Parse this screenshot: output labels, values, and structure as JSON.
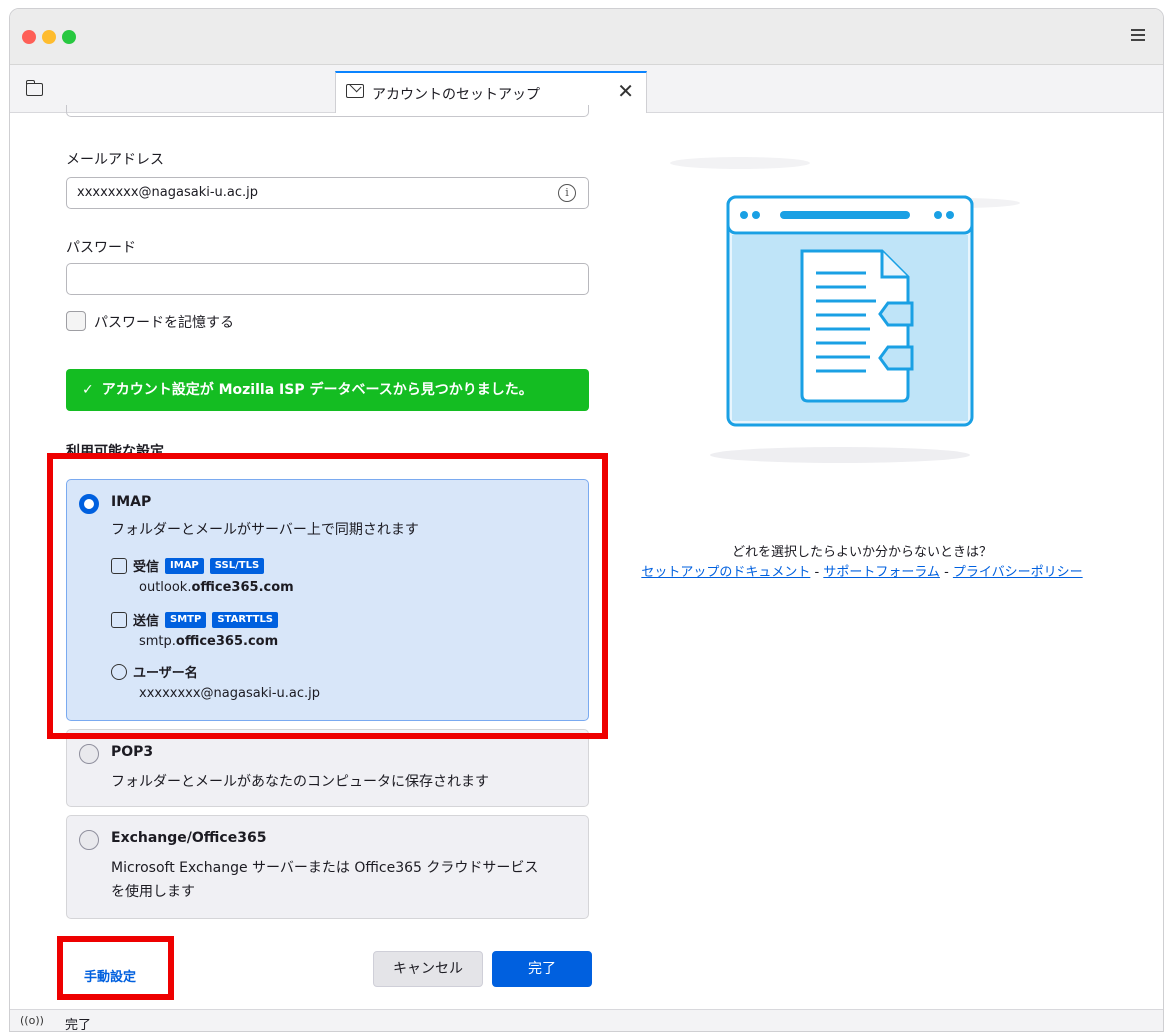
{
  "window": {
    "tab_title": "アカウントのセットアップ",
    "tab_close": "✕"
  },
  "form": {
    "email_label": "メールアドレス",
    "email_value": "xxxxxxxx@nagasaki-u.ac.jp",
    "password_label": "パスワード",
    "password_value": "",
    "remember_password_label": "パスワードを記憶する",
    "remember_password_checked": false
  },
  "notice": {
    "check": "✓",
    "text": "アカウント設定が Mozilla ISP データベースから見つかりました。"
  },
  "available": {
    "title": "利用可能な設定",
    "options": [
      {
        "title": "IMAP",
        "desc": "フォルダーとメールがサーバー上で同期されます",
        "selected": true,
        "incoming_label": "受信",
        "incoming_badges": [
          "IMAP",
          "SSL/TLS"
        ],
        "incoming_host_prefix": "outlook.",
        "incoming_host_bold": "office365.com",
        "outgoing_label": "送信",
        "outgoing_badges": [
          "SMTP",
          "STARTTLS"
        ],
        "outgoing_host_prefix": "smtp.",
        "outgoing_host_bold": "office365.com",
        "username_label": "ユーザー名",
        "username_value": "xxxxxxxx@nagasaki-u.ac.jp"
      },
      {
        "title": "POP3",
        "desc": "フォルダーとメールがあなたのコンピュータに保存されます",
        "selected": false
      },
      {
        "title": "Exchange/Office365",
        "desc": "Microsoft Exchange サーバーまたは Office365 クラウドサービスを使用します",
        "selected": false
      }
    ]
  },
  "actions": {
    "manual": "手動設定",
    "cancel": "キャンセル",
    "done": "完了"
  },
  "help": {
    "question": "どれを選択したらよいか分からないときは？",
    "link_docs": "セットアップのドキュメント",
    "sep1": " - ",
    "link_forum": "サポートフォーラム",
    "sep2": " - ",
    "link_privacy": "プライバシーポリシー"
  },
  "status": {
    "icon": "((o))",
    "text": "完了"
  },
  "colors": {
    "accent": "#0060df",
    "success": "#14bd22",
    "highlight": "#ee0000",
    "selected_bg": "#d8e6f9"
  },
  "icons": {
    "folder": "folder-icon",
    "tab": "mail-setup-icon",
    "info": "info-icon",
    "incoming": "inbox-icon",
    "outgoing": "outbox-icon",
    "user": "user-icon",
    "menu": "hamburger-menu-icon"
  }
}
